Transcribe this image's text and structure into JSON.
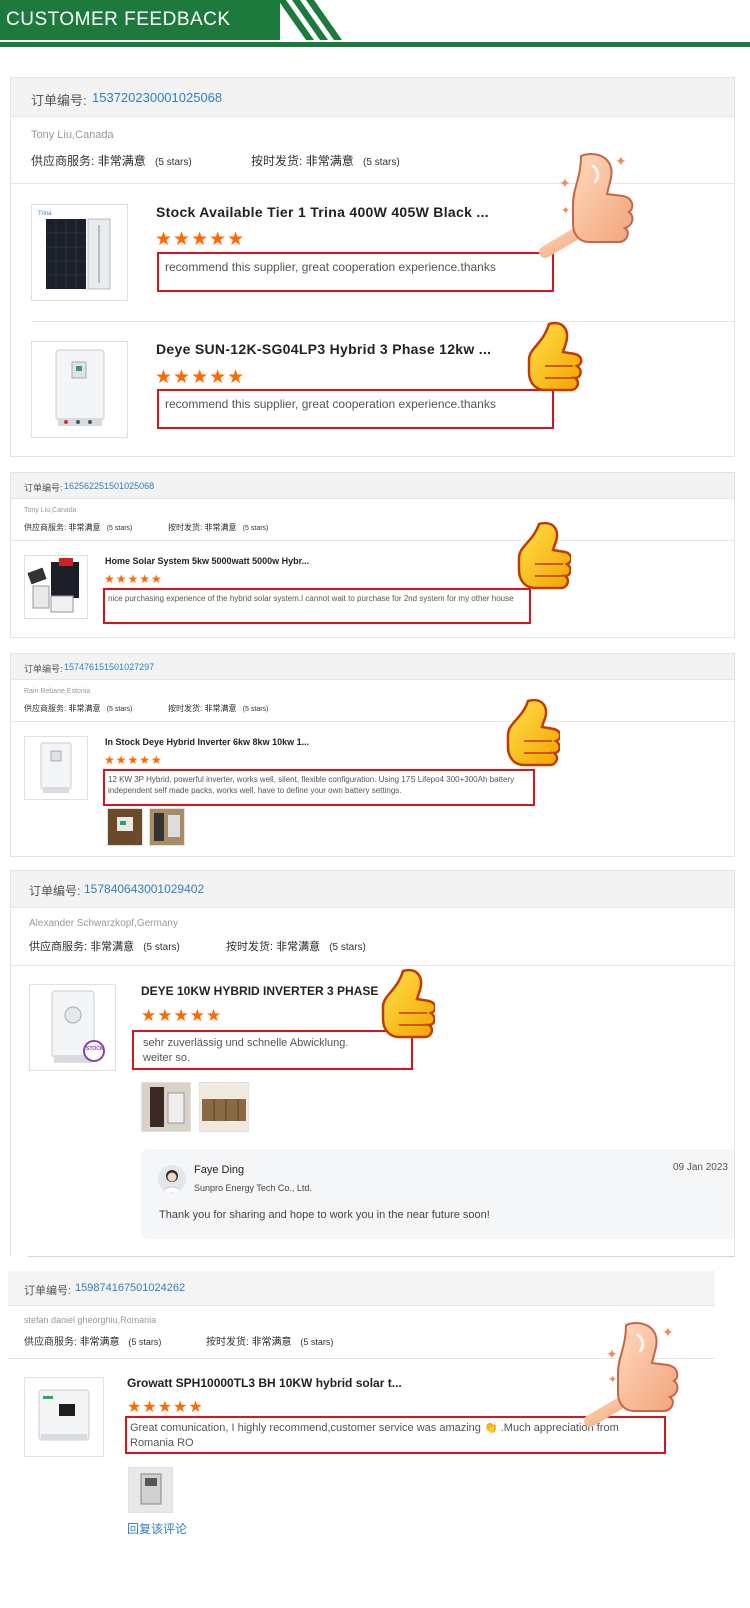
{
  "header": {
    "title": "CUSTOMER FEEDBACK"
  },
  "labels": {
    "order_no": "订单编号:",
    "supplier_service": "供应商服务:",
    "on_time": "按时发货:",
    "rating_text": "非常满意",
    "stars_text": "(5 stars)",
    "stars": "★★★★★"
  },
  "colors": {
    "brand_green": "#1e7a3c",
    "link_blue": "#2f7fc0",
    "star_orange": "#ff6a00",
    "highlight_red": "#d6161f"
  },
  "reviews": [
    {
      "order_id": "153720230001025068",
      "customer": "Tony Liu,Canada",
      "items": [
        {
          "title": "Stock Available Tier 1 Trina 400W 405W Black ...",
          "comment": "recommend this supplier, great cooperation experience.thanks"
        },
        {
          "title": "Deye SUN-12K-SG04LP3 Hybrid 3 Phase 12kw ...",
          "comment": "recommend this supplier, great cooperation experience.thanks"
        }
      ]
    },
    {
      "order_id": "162562251501025068",
      "customer": "Tony Liu,Canada",
      "items": [
        {
          "title": "Home Solar System 5kw 5000watt 5000w Hybr...",
          "comment": "nice purchasing experience of the hybrid solar system.I cannot wait to purchase for 2nd system for my other house"
        }
      ]
    },
    {
      "order_id": "157476151501027297",
      "customer": "Rain Rebane,Estonia",
      "items": [
        {
          "title": "In Stock Deye Hybrid Inverter 6kw 8kw 10kw 1...",
          "comment": "12 KW 3P Hybrid, powerful inverter, works well, silent, flexible configuration. Using 17S Lifepo4 300+300Ah battery independent self made packs, works well, have to define your own battery settings."
        }
      ]
    },
    {
      "order_id": "157840643001029402",
      "customer": "Alexander Schwarzkopf,Germany",
      "items": [
        {
          "title": "DEYE 10KW HYBRID INVERTER 3 PHASE",
          "comment": "sehr zuverlässig und schnelle Abwicklung.\nweiter so.",
          "badge": "STOCK"
        }
      ],
      "reply": {
        "name": "Faye Ding",
        "company": "Sunpro Energy Tech Co., Ltd.",
        "date": "09 Jan 2023",
        "text": "Thank you for sharing and hope to work you in the near future soon!"
      }
    },
    {
      "order_id": "159874167501024262",
      "customer": "stefan daniel gheorghiu,Romania",
      "items": [
        {
          "title": "Growatt SPH10000TL3 BH 10KW hybrid solar t...",
          "comment": "Great comunication, I highly recommend,customer service was amazing 👏 .Much appreciation from Romania RO"
        }
      ],
      "reply_link": "回复该评论"
    }
  ]
}
